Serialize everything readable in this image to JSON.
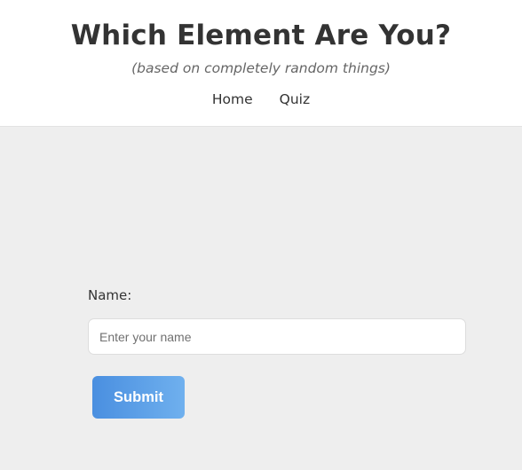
{
  "header": {
    "title": "Which Element Are You?",
    "subtitle": "(based on completely random things)",
    "nav": [
      {
        "label": "Home"
      },
      {
        "label": "Quiz"
      }
    ]
  },
  "form": {
    "name_label": "Name:",
    "name_input": {
      "value": "",
      "placeholder": "Enter your name"
    },
    "submit_label": "Submit"
  },
  "colors": {
    "header_bg": "#ffffff",
    "page_bg": "#eeeeee",
    "button_gradient_start": "#4a8fe0",
    "button_gradient_end": "#6fb0ee",
    "text": "#333333"
  }
}
